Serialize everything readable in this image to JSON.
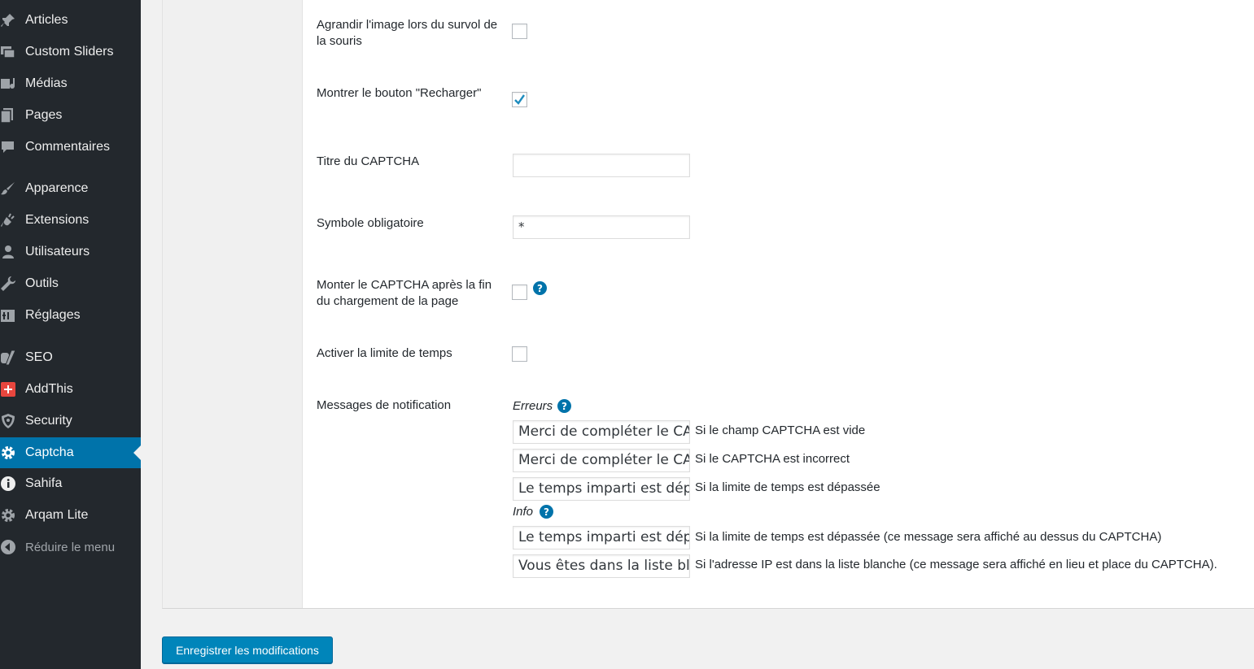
{
  "sidebar": {
    "items": [
      {
        "label": "Articles",
        "icon": "pin-icon"
      },
      {
        "label": "Custom Sliders",
        "icon": "sliders-icon"
      },
      {
        "label": "Médias",
        "icon": "media-icon"
      },
      {
        "label": "Pages",
        "icon": "pages-icon"
      },
      {
        "label": "Commentaires",
        "icon": "comment-icon"
      },
      {
        "label": "Apparence",
        "icon": "brush-icon"
      },
      {
        "label": "Extensions",
        "icon": "plugin-icon"
      },
      {
        "label": "Utilisateurs",
        "icon": "user-icon"
      },
      {
        "label": "Outils",
        "icon": "wrench-icon"
      },
      {
        "label": "Réglages",
        "icon": "settings-icon"
      },
      {
        "label": "SEO",
        "icon": "yoast-icon"
      },
      {
        "label": "AddThis",
        "icon": "addthis-icon"
      },
      {
        "label": "Security",
        "icon": "shield-icon"
      },
      {
        "label": "Captcha",
        "icon": "gear-icon",
        "active": true
      },
      {
        "label": "Sahifa",
        "icon": "info-icon"
      },
      {
        "label": "Arqam Lite",
        "icon": "gear-icon"
      },
      {
        "label": "Réduire le menu",
        "icon": "collapse-icon"
      }
    ]
  },
  "form": {
    "enlarge_label": "Agrandir l'image lors du survol de la souris",
    "enlarge_checked": false,
    "reload_label": "Montrer le bouton \"Recharger\"",
    "reload_checked": true,
    "title_label": "Titre du CAPTCHA",
    "title_value": "",
    "required_label": "Symbole obligatoire",
    "required_value": "*",
    "after_load_label": "Monter le CAPTCHA après la fin du chargement de la page",
    "after_load_checked": false,
    "time_limit_label": "Activer la limite de temps",
    "time_limit_checked": false,
    "notifications_label": "Messages de notification",
    "errors_heading": "Erreurs",
    "errors": [
      {
        "value": "Merci de compléter le CAPTCHA.",
        "description": "Si le champ CAPTCHA est vide"
      },
      {
        "value": "Merci de compléter le CAPTCHA.",
        "description": "Si le CAPTCHA est incorrect"
      },
      {
        "value": "Le temps imparti est dépassé.",
        "description": "Si la limite de temps est dépassée"
      }
    ],
    "info_heading": "Info",
    "info": [
      {
        "value": "Le temps imparti est dépassé.",
        "description": "Si la limite de temps est dépassée (ce message sera affiché au dessus du CAPTCHA)"
      },
      {
        "value": "Vous êtes dans la liste blanche.",
        "description": "Si l'adresse IP est dans la liste blanche (ce message sera affiché en lieu et place du CAPTCHA)."
      }
    ],
    "help_glyph": "?"
  },
  "save_label": "Enregistrer les modifications",
  "colors": {
    "accent": "#0073aa",
    "sidebar": "#23282d",
    "button": "#0085ba"
  }
}
